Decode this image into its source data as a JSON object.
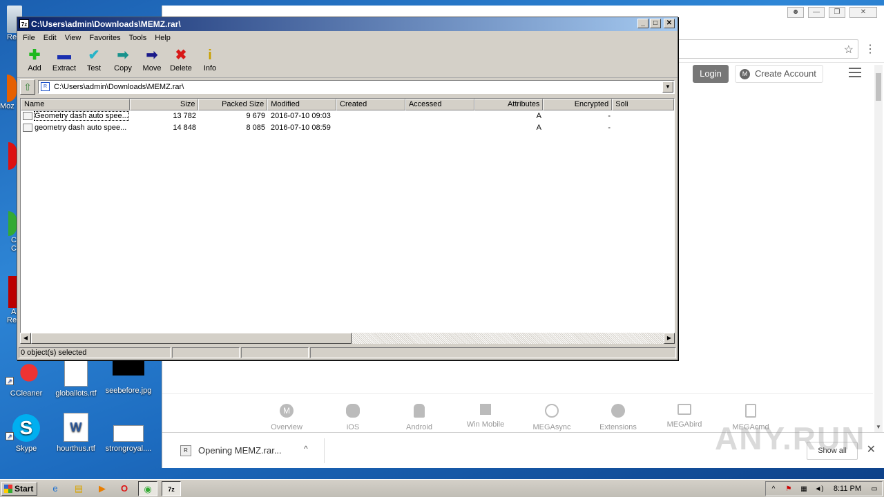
{
  "desktop": {
    "icons": [
      {
        "label": "CCleaner"
      },
      {
        "label": "globallots.rtf"
      },
      {
        "label": "seebefore.jpg"
      },
      {
        "label": "Skype"
      },
      {
        "label": "hourthus.rtf"
      },
      {
        "label": "strongroyal...."
      }
    ],
    "edge_labels": [
      "Re",
      "Moz",
      "C",
      "C",
      "A",
      "Re"
    ]
  },
  "chrome": {
    "login_label": "Login",
    "create_account_label": "Create Account",
    "platforms": [
      "Overview",
      "iOS",
      "Android",
      "Win Mobile",
      "MEGAsync",
      "Extensions",
      "MEGAbird",
      "MEGAcmd"
    ],
    "download": {
      "filename": "Opening MEMZ.rar...",
      "show_all_label": "Show all"
    },
    "watermark": "ANY.RUN"
  },
  "zip": {
    "title": "C:\\Users\\admin\\Downloads\\MEMZ.rar\\",
    "app_icon_text": "7z",
    "menu": [
      "File",
      "Edit",
      "View",
      "Favorites",
      "Tools",
      "Help"
    ],
    "toolbar": [
      {
        "label": "Add",
        "icon": "plus-icon",
        "color": "#1fb81f"
      },
      {
        "label": "Extract",
        "icon": "minus-icon",
        "color": "#1a2fb0"
      },
      {
        "label": "Test",
        "icon": "check-icon",
        "color": "#27b4c8"
      },
      {
        "label": "Copy",
        "icon": "copy-arrow-icon",
        "color": "#17928c"
      },
      {
        "label": "Move",
        "icon": "move-arrow-icon",
        "color": "#1a1a8a"
      },
      {
        "label": "Delete",
        "icon": "delete-x-icon",
        "color": "#d81818"
      },
      {
        "label": "Info",
        "icon": "info-icon",
        "color": "#c8a000"
      }
    ],
    "address": "C:\\Users\\admin\\Downloads\\MEMZ.rar\\",
    "columns": [
      "Name",
      "Size",
      "Packed Size",
      "Modified",
      "Created",
      "Accessed",
      "Attributes",
      "Encrypted",
      "Soli"
    ],
    "rows": [
      {
        "name": "Geometry dash auto spee...",
        "size": "13 782",
        "packed": "9 679",
        "modified": "2016-07-10 09:03",
        "created": "",
        "accessed": "",
        "attributes": "A",
        "encrypted": "-"
      },
      {
        "name": "geometry dash auto spee...",
        "size": "14 848",
        "packed": "8 085",
        "modified": "2016-07-10 08:59",
        "created": "",
        "accessed": "",
        "attributes": "A",
        "encrypted": "-"
      }
    ],
    "status": "0 object(s) selected"
  },
  "taskbar": {
    "start_label": "Start",
    "clock": "8:11 PM"
  }
}
